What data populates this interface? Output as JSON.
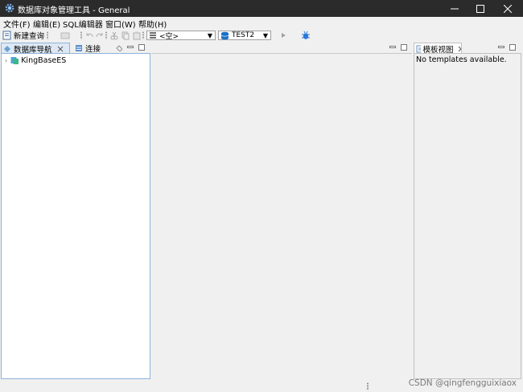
{
  "window": {
    "title": "数据库对象管理工具 - General",
    "icon": "gear-icon",
    "controls": [
      "minimize-icon",
      "maximize-icon",
      "close-icon"
    ]
  },
  "menu": {
    "items": [
      {
        "label": "文件(F)"
      },
      {
        "label": "编辑(E)"
      },
      {
        "label": "SQL编辑器"
      },
      {
        "label": "窗口(W)"
      },
      {
        "label": "帮助(H)"
      }
    ]
  },
  "toolbar": {
    "new_query_label": "新建查询",
    "schema_combo_value": "<空>",
    "db_combo_value": "TEST2",
    "accent_color": "#1a6fc9"
  },
  "left_panel": {
    "tabs": [
      {
        "label": "数据库导航",
        "active": true
      },
      {
        "label": "连接",
        "active": false
      }
    ],
    "tree": [
      {
        "label": "KingBaseES",
        "expanded": false
      }
    ],
    "border_color": "#8cb4d9"
  },
  "right_panel": {
    "tab_label": "模板视图",
    "message": "No templates available."
  },
  "watermark": "CSDN @qingfengguixiaox"
}
